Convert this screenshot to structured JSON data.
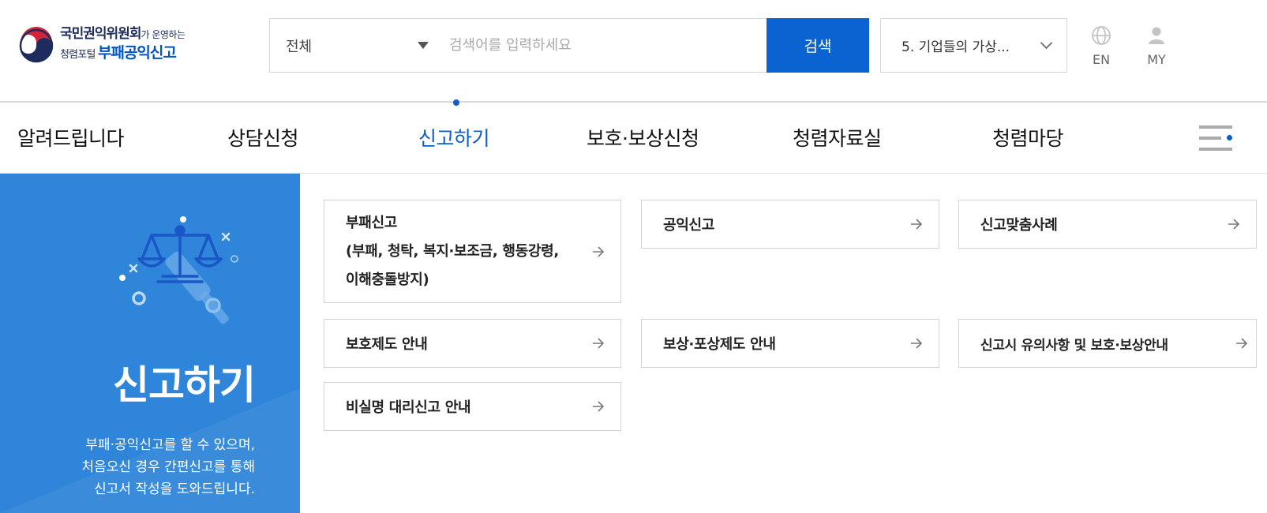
{
  "header": {
    "logo": {
      "org": "국민권익위원회",
      "org_suffix": "가 운영하는",
      "portal_prefix": "청렴포털",
      "portal_name": "부패공익신고"
    },
    "search": {
      "category": "전체",
      "placeholder": "검색어를 입력하세요",
      "button_label": "검색"
    },
    "popular_keyword": "5. 기업들의 가상...",
    "utils": [
      {
        "label": "EN",
        "icon": "globe-icon"
      },
      {
        "label": "MY",
        "icon": "user-icon"
      }
    ]
  },
  "gnb": {
    "items": [
      {
        "label": "알려드립니다"
      },
      {
        "label": "상담신청"
      },
      {
        "label": "신고하기",
        "active": true
      },
      {
        "label": "보호·보상신청"
      },
      {
        "label": "청렴자료실"
      },
      {
        "label": "청렴마당"
      }
    ],
    "menu_icon": "hamburger-menu-icon"
  },
  "side": {
    "title": "신고하기",
    "desc_lines": [
      "부패·공익신고를 할 수 있으며,",
      "처음오신 경우 간편신고를 통해",
      "신고서 작성을 도와드립니다."
    ],
    "illustration_icon": "scales-of-justice-icon"
  },
  "submenu": [
    {
      "lines": [
        "부패신고",
        "(부패, 청탁, 복지·보조금, 행동강령,",
        "이해충돌방지)"
      ]
    },
    {
      "label": "공익신고"
    },
    {
      "label": "신고맞춤사례"
    },
    {
      "label": "보호제도 안내"
    },
    {
      "label": "보상·포상제도 안내"
    },
    {
      "label": "신고시 유의사항 및 보호·보상안내"
    },
    {
      "label": "비실명 대리신고 안내"
    }
  ],
  "colors": {
    "brand_blue": "#0a63d0",
    "side_panel": "#2e85d9",
    "active_nav": "#0a5fc8",
    "logo_navy": "#1d2c5c"
  }
}
